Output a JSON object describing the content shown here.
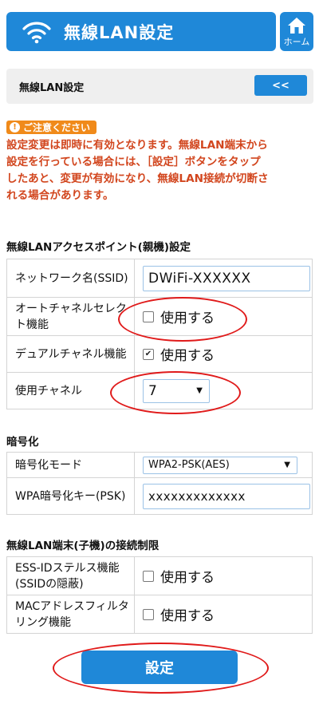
{
  "header": {
    "title": "無線LAN設定",
    "home_label": "ホーム"
  },
  "subbar": {
    "label": "無線LAN設定",
    "back_label": "<<"
  },
  "caution": {
    "badge": "ご注意ください",
    "lines": [
      "設定変更は即時に有効となります。無線LAN端末から",
      "設定を行っている場合には、［設定］ボタンをタップ",
      "したあと、変更が有効になり、無線LAN接続が切断さ",
      "れる場合があります。"
    ]
  },
  "ap_section": {
    "title": "無線LANアクセスポイント(親機)設定",
    "ssid": {
      "label": "ネットワーク名(SSID)",
      "value": "DWiFi-XXXXXX"
    },
    "auto_channel": {
      "label": "オートチャネルセレクト機能",
      "option": "使用する",
      "checked": false
    },
    "dual_channel": {
      "label": "デュアルチャネル機能",
      "option": "使用する",
      "checked": true
    },
    "channel": {
      "label": "使用チャネル",
      "value": "7"
    }
  },
  "enc_section": {
    "title": "暗号化",
    "mode": {
      "label": "暗号化モード",
      "value": "WPA2-PSK(AES)"
    },
    "key": {
      "label": "WPA暗号化キー(PSK)",
      "value": "xxxxxxxxxxxxx"
    }
  },
  "limit_section": {
    "title": "無線LAN端末(子機)の接続制限",
    "stealth": {
      "label": "ESS-IDステルス機能(SSIDの隠蔽)",
      "option": "使用する",
      "checked": false
    },
    "mac_filter": {
      "label": "MACアドレスフィルタリング機能",
      "option": "使用する",
      "checked": false
    }
  },
  "submit_label": "設定",
  "colors": {
    "primary": "#1f88d8",
    "caution": "#d2461e",
    "badge": "#f08a1a",
    "highlight": "#e01a1a"
  },
  "icons": {
    "wifi": "wifi-icon",
    "home": "home-icon",
    "caution": "exclamation-icon",
    "select_arrow": "triangle-down-icon"
  }
}
